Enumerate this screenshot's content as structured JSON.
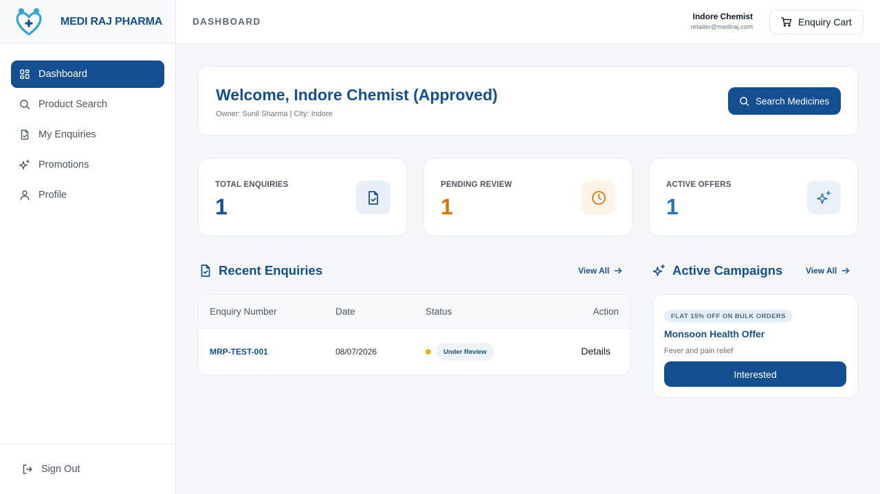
{
  "brand": {
    "name": "MEDI RAJ PHARMA",
    "logo_icon": "heart-plus-logo-icon"
  },
  "sidebar": {
    "items": [
      {
        "label": "Dashboard",
        "icon": "grid-icon",
        "active": true
      },
      {
        "label": "Product Search",
        "icon": "search-icon",
        "active": false
      },
      {
        "label": "My Enquiries",
        "icon": "file-check-icon",
        "active": false
      },
      {
        "label": "Promotions",
        "icon": "sparkles-icon",
        "active": false
      },
      {
        "label": "Profile",
        "icon": "user-icon",
        "active": false
      }
    ],
    "signout_label": "Sign Out"
  },
  "header": {
    "title": "DASHBOARD",
    "user_name": "Indore Chemist",
    "user_email": "retailer@mediraj.com",
    "cart_label": "Enquiry Cart"
  },
  "welcome": {
    "title": "Welcome, Indore Chemist (Approved)",
    "subtitle": "Owner: Sunil Sharma | City: Indore",
    "search_button": "Search Medicines"
  },
  "stats": [
    {
      "label": "TOTAL ENQUIRIES",
      "value": "1",
      "color": "#134f91",
      "icon": "file-check-icon"
    },
    {
      "label": "PENDING REVIEW",
      "value": "1",
      "color": "#d97706",
      "icon": "clock-icon"
    },
    {
      "label": "ACTIVE OFFERS",
      "value": "1",
      "color": "#2b6fc4",
      "icon": "sparkles-icon"
    }
  ],
  "recent": {
    "title": "Recent Enquiries",
    "view_all": "View All",
    "columns": [
      "Enquiry Number",
      "Date",
      "Status",
      "Action"
    ],
    "rows": [
      {
        "number": "MRP-TEST-001",
        "date": "08/07/2026",
        "status": "Under Review",
        "action": "Details"
      }
    ]
  },
  "campaigns": {
    "title": "Active Campaigns",
    "view_all": "View All",
    "items": [
      {
        "badge": "FLAT 15% OFF ON BULK ORDERS",
        "title": "Monsoon Health Offer",
        "description": "Fever and pain relief",
        "button": "Interested"
      }
    ]
  },
  "colors": {
    "primary": "#134f91",
    "pending": "#d97706",
    "offers": "#2b6fc4",
    "status_dot": "#eab308"
  }
}
